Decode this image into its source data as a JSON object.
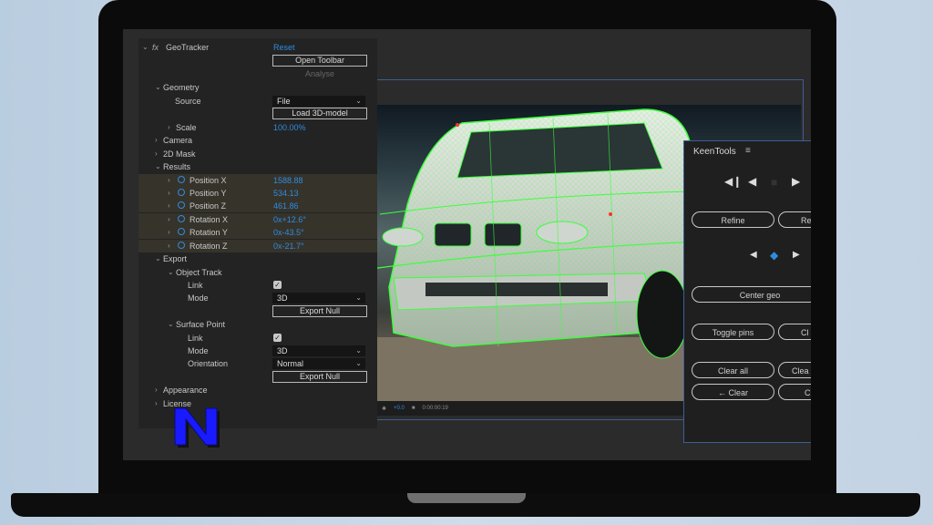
{
  "effect_panel": {
    "fx_badge": "fx",
    "effect_name": "GeoTracker",
    "reset": "Reset",
    "open_toolbar": "Open Toolbar",
    "analyse": "Analyse",
    "geometry": "Geometry",
    "source_label": "Source",
    "source_value": "File",
    "load_model": "Load 3D-model",
    "scale_label": "Scale",
    "scale_value": "100.00%",
    "camera": "Camera",
    "mask": "2D Mask",
    "results": "Results",
    "position_x_label": "Position X",
    "position_x_value": "1588.88",
    "position_y_label": "Position Y",
    "position_y_value": "534.13",
    "position_z_label": "Position Z",
    "position_z_value": "461.86",
    "rotation_x_label": "Rotation X",
    "rotation_x_value": "0x+12.6°",
    "rotation_y_label": "Rotation Y",
    "rotation_y_value": "0x-43.5°",
    "rotation_z_label": "Rotation Z",
    "rotation_z_value": "0x-21.7°",
    "export": "Export",
    "object_track": "Object Track",
    "ot_link_label": "Link",
    "ot_mode_label": "Mode",
    "ot_mode_value": "3D",
    "ot_export_null": "Export Null",
    "surface_point": "Surface Point",
    "sp_link_label": "Link",
    "sp_mode_label": "Mode",
    "sp_mode_value": "3D",
    "orientation_label": "Orientation",
    "orientation_value": "Normal",
    "sp_export_null": "Export Null",
    "appearance": "Appearance",
    "license": "License"
  },
  "keen_panel": {
    "title": "KeenTools",
    "refine": "Refine",
    "refine_all": "Re",
    "center_geo": "Center geo",
    "toggle_pins": "Toggle pins",
    "clear_pins": "Cl",
    "clear_all": "Clear all",
    "clear_between": "Clea",
    "clear_left": "← Clear",
    "clear_right": "C"
  },
  "viewer_bar": {
    "exposure": "+0.0",
    "timecode": "0:00:00:19"
  },
  "colors": {
    "accent_blue": "#2e8ce0",
    "tracking_green": "#3bff3b",
    "logo_blue": "#1a1aff"
  }
}
